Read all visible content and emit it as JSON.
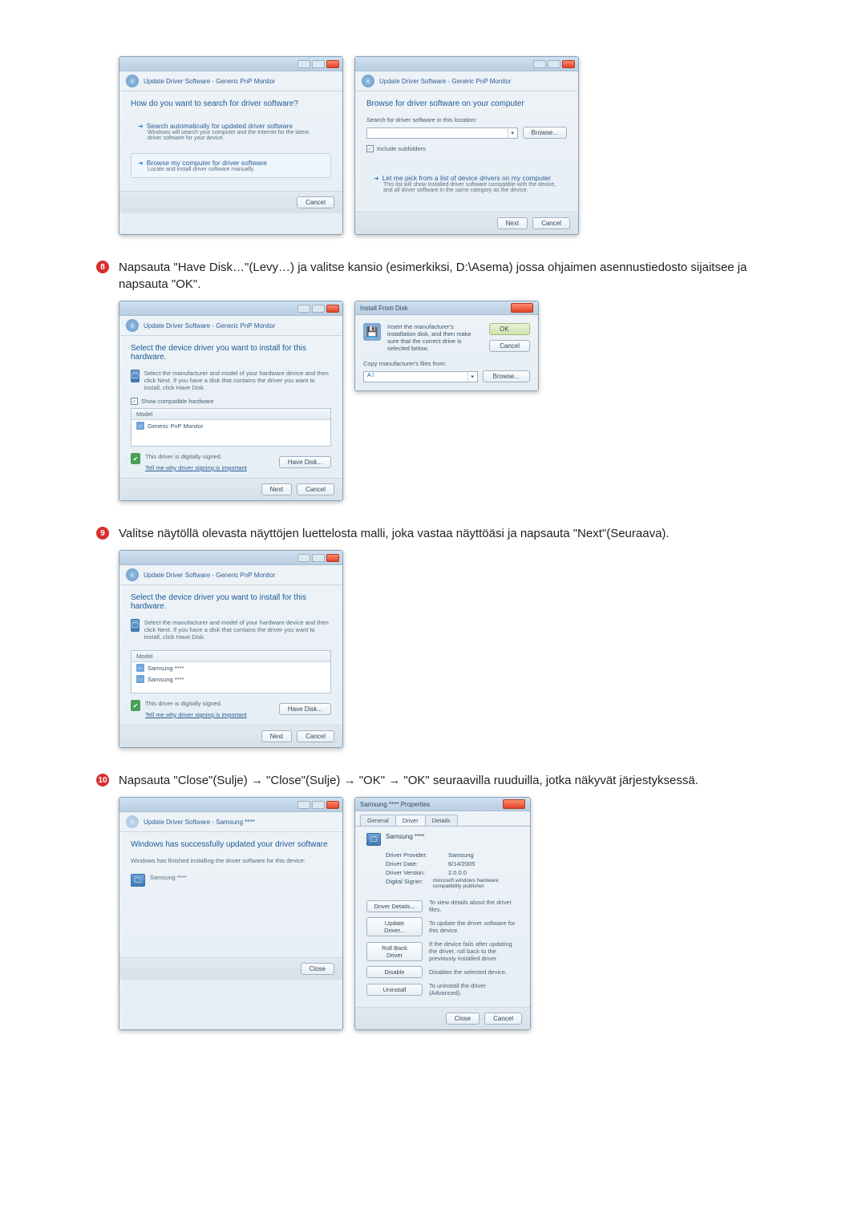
{
  "steps": {
    "s8": {
      "num": "8",
      "text": "Napsauta \"Have Disk…\"(Levy…) ja valitse kansio (esimerkiksi, D:\\Asema) jossa ohjaimen asennustiedosto sijaitsee ja napsauta \"OK\"."
    },
    "s9": {
      "num": "9",
      "text": "Valitse näytöllä olevasta näyttöjen luettelosta malli, joka vastaa näyttöäsi ja napsauta \"Next\"(Seuraava)."
    },
    "s10": {
      "num": "10",
      "text": "Napsauta \"Close\"(Sulje) → \"Close\"(Sulje) → \"OK\" → \"OK\" seuraavilla ruuduilla, jotka näkyvät järjestyksessä."
    }
  },
  "common": {
    "breadcrumb": "Update Driver Software - Generic PnP Monitor",
    "breadcrumb_samsung": "Update Driver Software - Samsung ****",
    "cancel": "Cancel",
    "next": "Next",
    "close": "Close",
    "ok": "OK",
    "browse": "Browse...",
    "have_disk": "Have Disk...",
    "model_hdr": "Model"
  },
  "dlg1": {
    "heading": "How do you want to search for driver software?",
    "opt1_title": "Search automatically for updated driver software",
    "opt1_desc": "Windows will search your computer and the Internet for the latest driver software for your device.",
    "opt2_title": "Browse my computer for driver software",
    "opt2_desc": "Locate and install driver software manually."
  },
  "dlg2": {
    "heading": "Browse for driver software on your computer",
    "search_label": "Search for driver software in this location:",
    "include": "Include subfolders",
    "opt_title": "Let me pick from a list of device drivers on my computer",
    "opt_desc": "This list will show installed driver software compatible with the device, and all driver software in the same category as the device."
  },
  "dlg3": {
    "heading": "Select the device driver you want to install for this hardware.",
    "note": "Select the manufacturer and model of your hardware device and then click Next. If you have a disk that contains the driver you want to install, click Have Disk.",
    "show_compat": "Show compatible hardware",
    "model_item": "Generic PnP Monitor",
    "signed": "This driver is digitally signed.",
    "tell": "Tell me why driver signing is important"
  },
  "dlg4": {
    "title": "Install From Disk",
    "msg": "Insert the manufacturer's installation disk, and then make sure that the correct drive is selected below.",
    "copy": "Copy manufacturer's files from:",
    "path": "A:\\"
  },
  "dlg5": {
    "model_a": "Samsung ****",
    "model_b": "Samsung ****"
  },
  "dlg6": {
    "heading": "Windows has successfully updated your driver software",
    "sub": "Windows has finished installing the driver software for this device:",
    "model": "Samsung ****"
  },
  "dlg7": {
    "title": "Samsung **** Properties",
    "tab_general": "General",
    "tab_driver": "Driver",
    "tab_details": "Details",
    "name": "Samsung ****",
    "provider_k": "Driver Provider:",
    "provider_v": "Samsung",
    "date_k": "Driver Date:",
    "date_v": "6/14/2005",
    "ver_k": "Driver Version:",
    "ver_v": "2.0.0.0",
    "signer_k": "Digital Signer:",
    "signer_v": "microsoft windows hardware compatibility publisher",
    "details_btn": "Driver Details...",
    "details_txt": "To view details about the driver files.",
    "update_btn": "Update Driver...",
    "update_txt": "To update the driver software for this device.",
    "rollback_btn": "Roll Back Driver",
    "rollback_txt": "If the device fails after updating the driver, roll back to the previously installed driver.",
    "disable_btn": "Disable",
    "disable_txt": "Disables the selected device.",
    "uninstall_btn": "Uninstall",
    "uninstall_txt": "To uninstall the driver (Advanced)."
  }
}
